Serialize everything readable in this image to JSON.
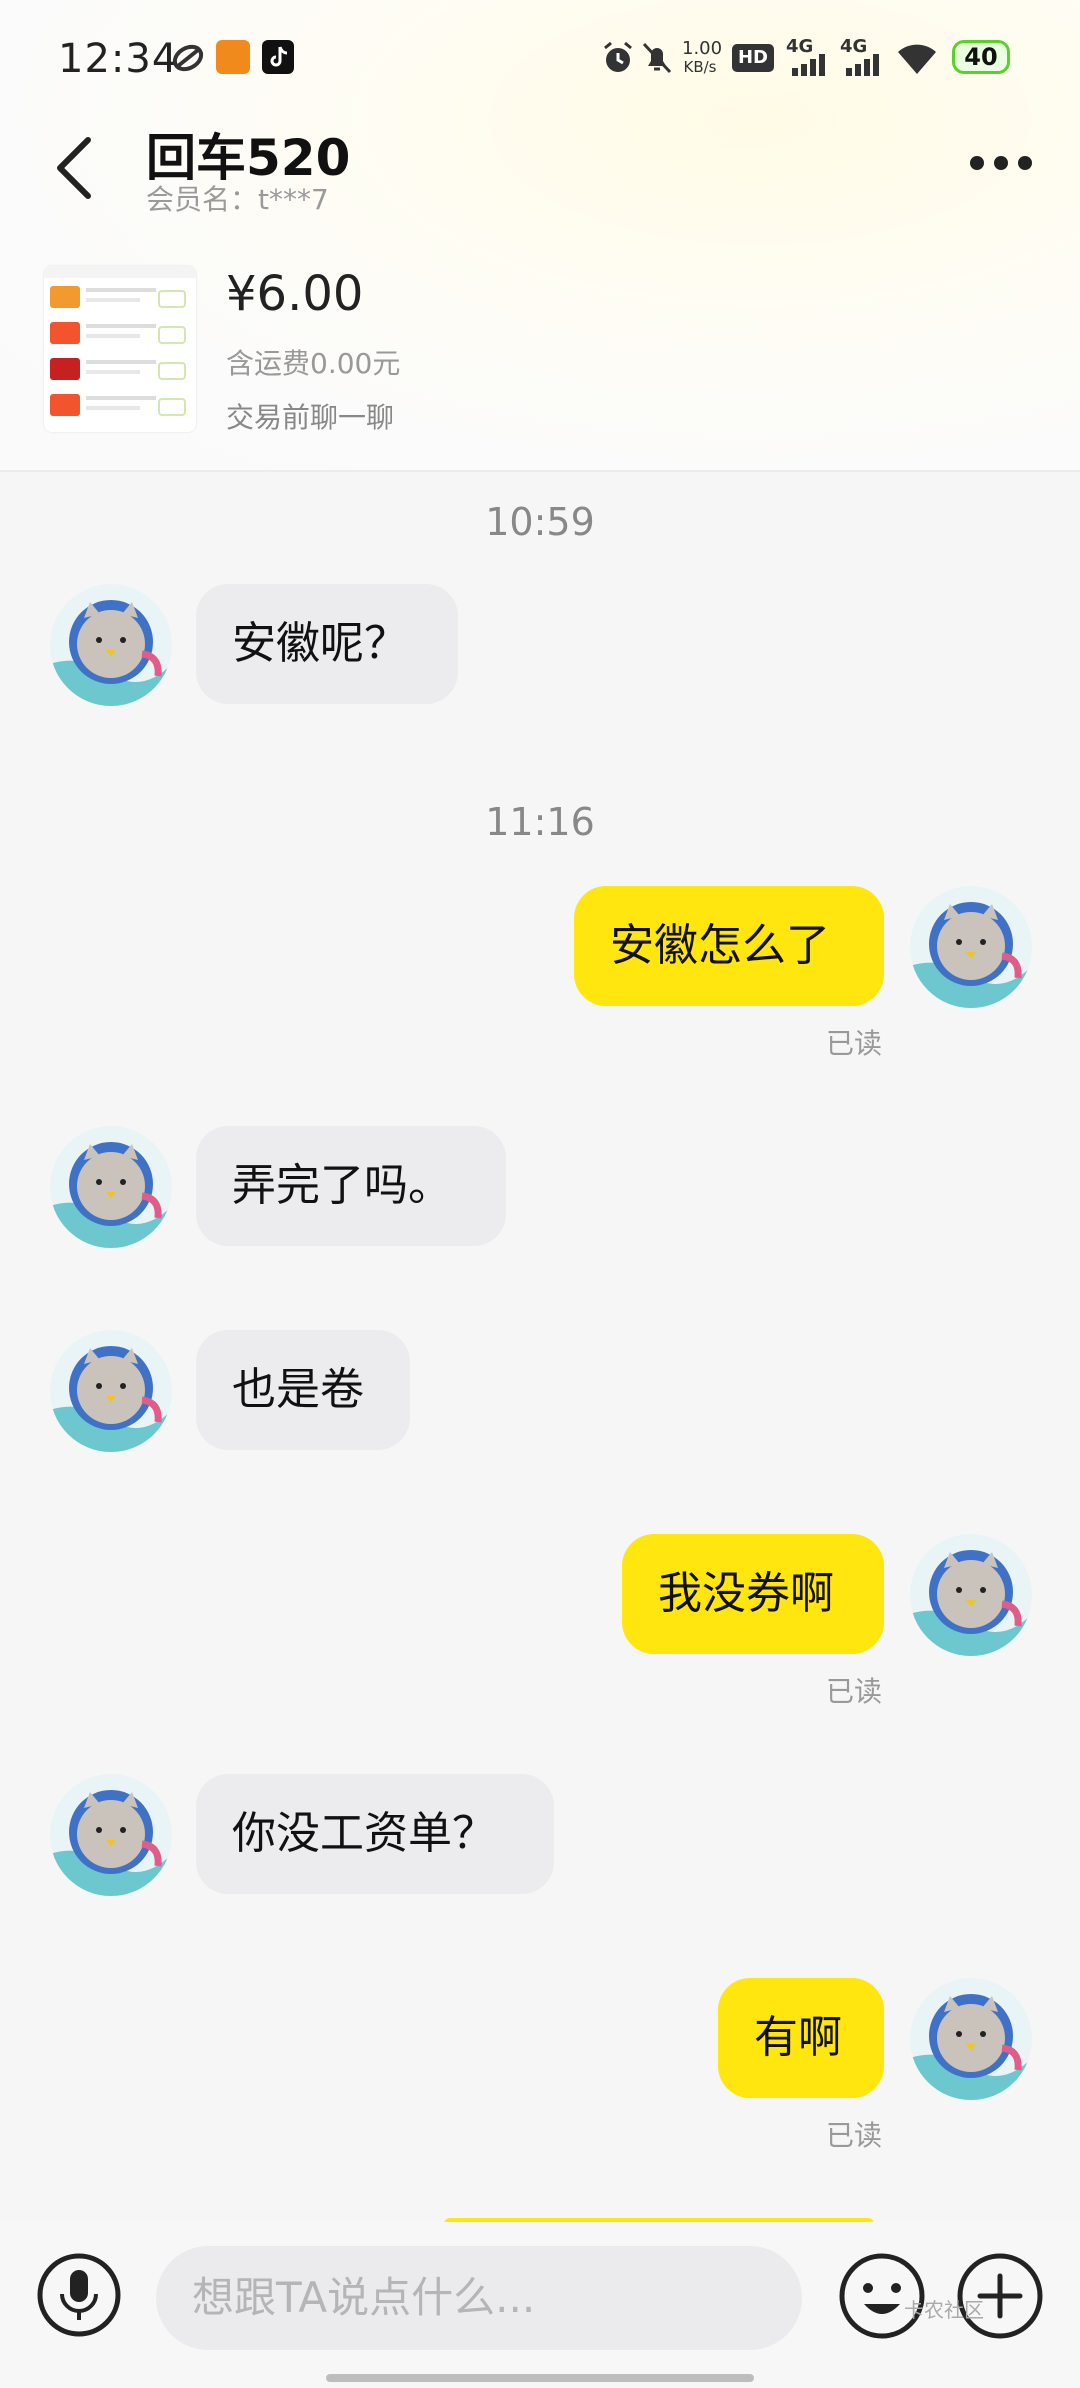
{
  "status_bar": {
    "time": "12:34",
    "network_speed_top": "1.00",
    "network_speed_unit": "KB/s",
    "hd_label": "HD",
    "sim1": "4G",
    "sim2": "4G",
    "battery": "40",
    "icons": [
      "app-icon-1",
      "bank-app-icon",
      "tiktok-icon",
      "alarm-icon",
      "mute-icon",
      "hd-icon",
      "signal-icon",
      "signal-icon",
      "wifi-icon",
      "battery-icon"
    ]
  },
  "header": {
    "title": "回车520",
    "member": "会员名：t***7",
    "back_icon": "chevron-left-icon",
    "more_icon": "more-dots-icon"
  },
  "product": {
    "price": "¥6.00",
    "shipping": "含运费0.00元",
    "hint": "交易前聊一聊"
  },
  "chat": {
    "timestamps": [
      "10:59",
      "11:16"
    ],
    "read_label": "已读",
    "messages": [
      {
        "side": "left",
        "text": "安徽呢？"
      },
      {
        "side": "right",
        "text": "安徽怎么了"
      },
      {
        "side": "left",
        "text": "弄完了吗。"
      },
      {
        "side": "left",
        "text": "也是卷"
      },
      {
        "side": "right",
        "text": "我没券啊"
      },
      {
        "side": "left",
        "text": "你没工资单？"
      },
      {
        "side": "right",
        "text": "有啊"
      }
    ]
  },
  "input_bar": {
    "placeholder": "想跟TA说点什么...",
    "watermark": "卡农社区"
  },
  "colors": {
    "accent": "#ffe60f",
    "left_bubble": "#ececee",
    "battery_green": "#5ad12a"
  }
}
